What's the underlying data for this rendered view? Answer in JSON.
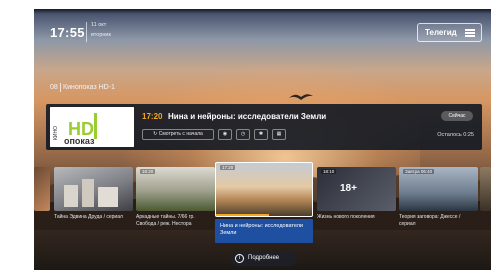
{
  "status": {
    "time": "17:55",
    "date": "11 окт",
    "weekday": "вторник"
  },
  "header": {
    "guide_label": "Телегид"
  },
  "channel": {
    "number": "08",
    "name": "Кинопоказ HD-1",
    "logo_text_top": "КИНО",
    "logo_text_hd": "HD",
    "logo_text_bottom": "опоказ"
  },
  "now_playing": {
    "time": "17:20",
    "title": "Нина и нейроны: исследователи Земли",
    "badge": "Сейчас",
    "remaining": "Осталось 0:25",
    "watch_label": "Смотреть с начала",
    "progress": 0.55
  },
  "cards": [
    {
      "time": "",
      "caption": "Тайна Эдвина Друда / сериал"
    },
    {
      "time": "16:20",
      "caption": "Аркадные тайны. 7/66 гр. Свобода / реж. Нестора"
    },
    {
      "time": "17:20",
      "caption": "Нина и нейроны: исследователи Земли"
    },
    {
      "time": "18:10",
      "caption": "Жизнь нового поколения",
      "rating": "18+"
    },
    {
      "time": "Завтра 06:40",
      "caption": "Теория заговора: Джессе / сериал"
    }
  ],
  "details": {
    "label": "Подробнее"
  }
}
